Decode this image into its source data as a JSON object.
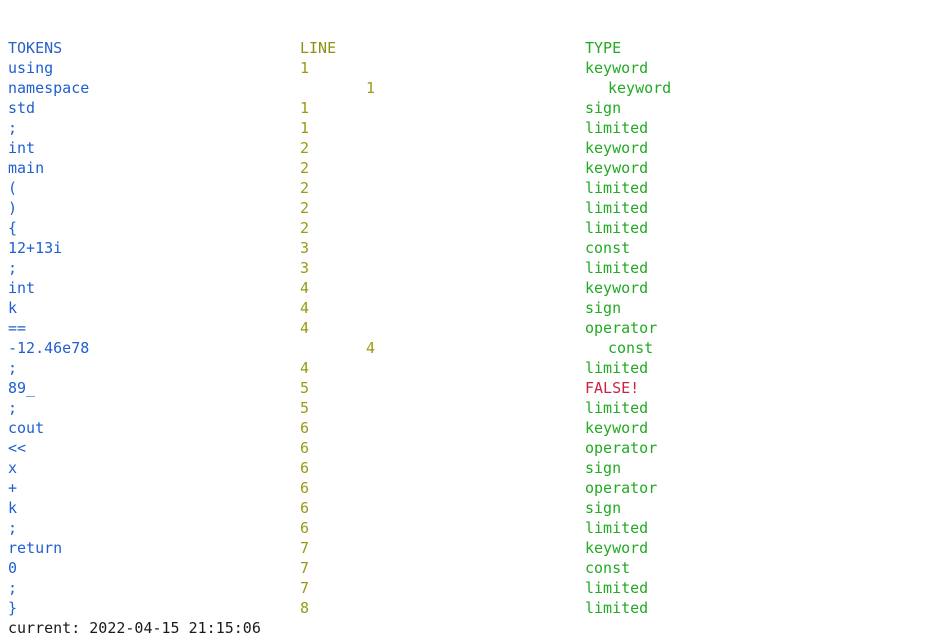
{
  "separator": "-----------------------------",
  "columns": {
    "token_header": "TOKENS",
    "line_header": "LINE",
    "type_header": "TYPE"
  },
  "colors": {
    "token": "#1f5fd0",
    "line": "#9a9a16",
    "type": "#22aa22",
    "error": "#cc2244",
    "footer": "#1a1a1a",
    "background": "#ffffff"
  },
  "rows": [
    {
      "token": "using",
      "line": "1",
      "type": "keyword",
      "shift": false,
      "error": false
    },
    {
      "token": "namespace",
      "line": "1",
      "type": "keyword",
      "shift": true,
      "error": false
    },
    {
      "token": "std",
      "line": "1",
      "type": "sign",
      "shift": false,
      "error": false
    },
    {
      "token": ";",
      "line": "1",
      "type": "limited",
      "shift": false,
      "error": false
    },
    {
      "token": "int",
      "line": "2",
      "type": "keyword",
      "shift": false,
      "error": false
    },
    {
      "token": "main",
      "line": "2",
      "type": "keyword",
      "shift": false,
      "error": false
    },
    {
      "token": "(",
      "line": "2",
      "type": "limited",
      "shift": false,
      "error": false
    },
    {
      "token": ")",
      "line": "2",
      "type": "limited",
      "shift": false,
      "error": false
    },
    {
      "token": "{",
      "line": "2",
      "type": "limited",
      "shift": false,
      "error": false
    },
    {
      "token": "12+13i",
      "line": "3",
      "type": "const",
      "shift": false,
      "error": false
    },
    {
      "token": ";",
      "line": "3",
      "type": "limited",
      "shift": false,
      "error": false
    },
    {
      "token": "int",
      "line": "4",
      "type": "keyword",
      "shift": false,
      "error": false
    },
    {
      "token": "k",
      "line": "4",
      "type": "sign",
      "shift": false,
      "error": false
    },
    {
      "token": "==",
      "line": "4",
      "type": "operator",
      "shift": false,
      "error": false
    },
    {
      "token": "-12.46e78",
      "line": "4",
      "type": "const",
      "shift": true,
      "error": false
    },
    {
      "token": ";",
      "line": "4",
      "type": "limited",
      "shift": false,
      "error": false
    },
    {
      "token": "89_",
      "line": "5",
      "type": "FALSE!",
      "shift": false,
      "error": true
    },
    {
      "token": ";",
      "line": "5",
      "type": "limited",
      "shift": false,
      "error": false
    },
    {
      "token": "cout",
      "line": "6",
      "type": "keyword",
      "shift": false,
      "error": false
    },
    {
      "token": "<<",
      "line": "6",
      "type": "operator",
      "shift": false,
      "error": false
    },
    {
      "token": "x",
      "line": "6",
      "type": "sign",
      "shift": false,
      "error": false
    },
    {
      "token": "+",
      "line": "6",
      "type": "operator",
      "shift": false,
      "error": false
    },
    {
      "token": "k",
      "line": "6",
      "type": "sign",
      "shift": false,
      "error": false
    },
    {
      "token": ";",
      "line": "6",
      "type": "limited",
      "shift": false,
      "error": false
    },
    {
      "token": "return",
      "line": "7",
      "type": "keyword",
      "shift": false,
      "error": false
    },
    {
      "token": "0",
      "line": "7",
      "type": "const",
      "shift": false,
      "error": false
    },
    {
      "token": ";",
      "line": "7",
      "type": "limited",
      "shift": false,
      "error": false
    },
    {
      "token": "}",
      "line": "8",
      "type": "limited",
      "shift": false,
      "error": false
    }
  ],
  "footer": {
    "status": "current: 2022-04-15 21:15:06"
  }
}
